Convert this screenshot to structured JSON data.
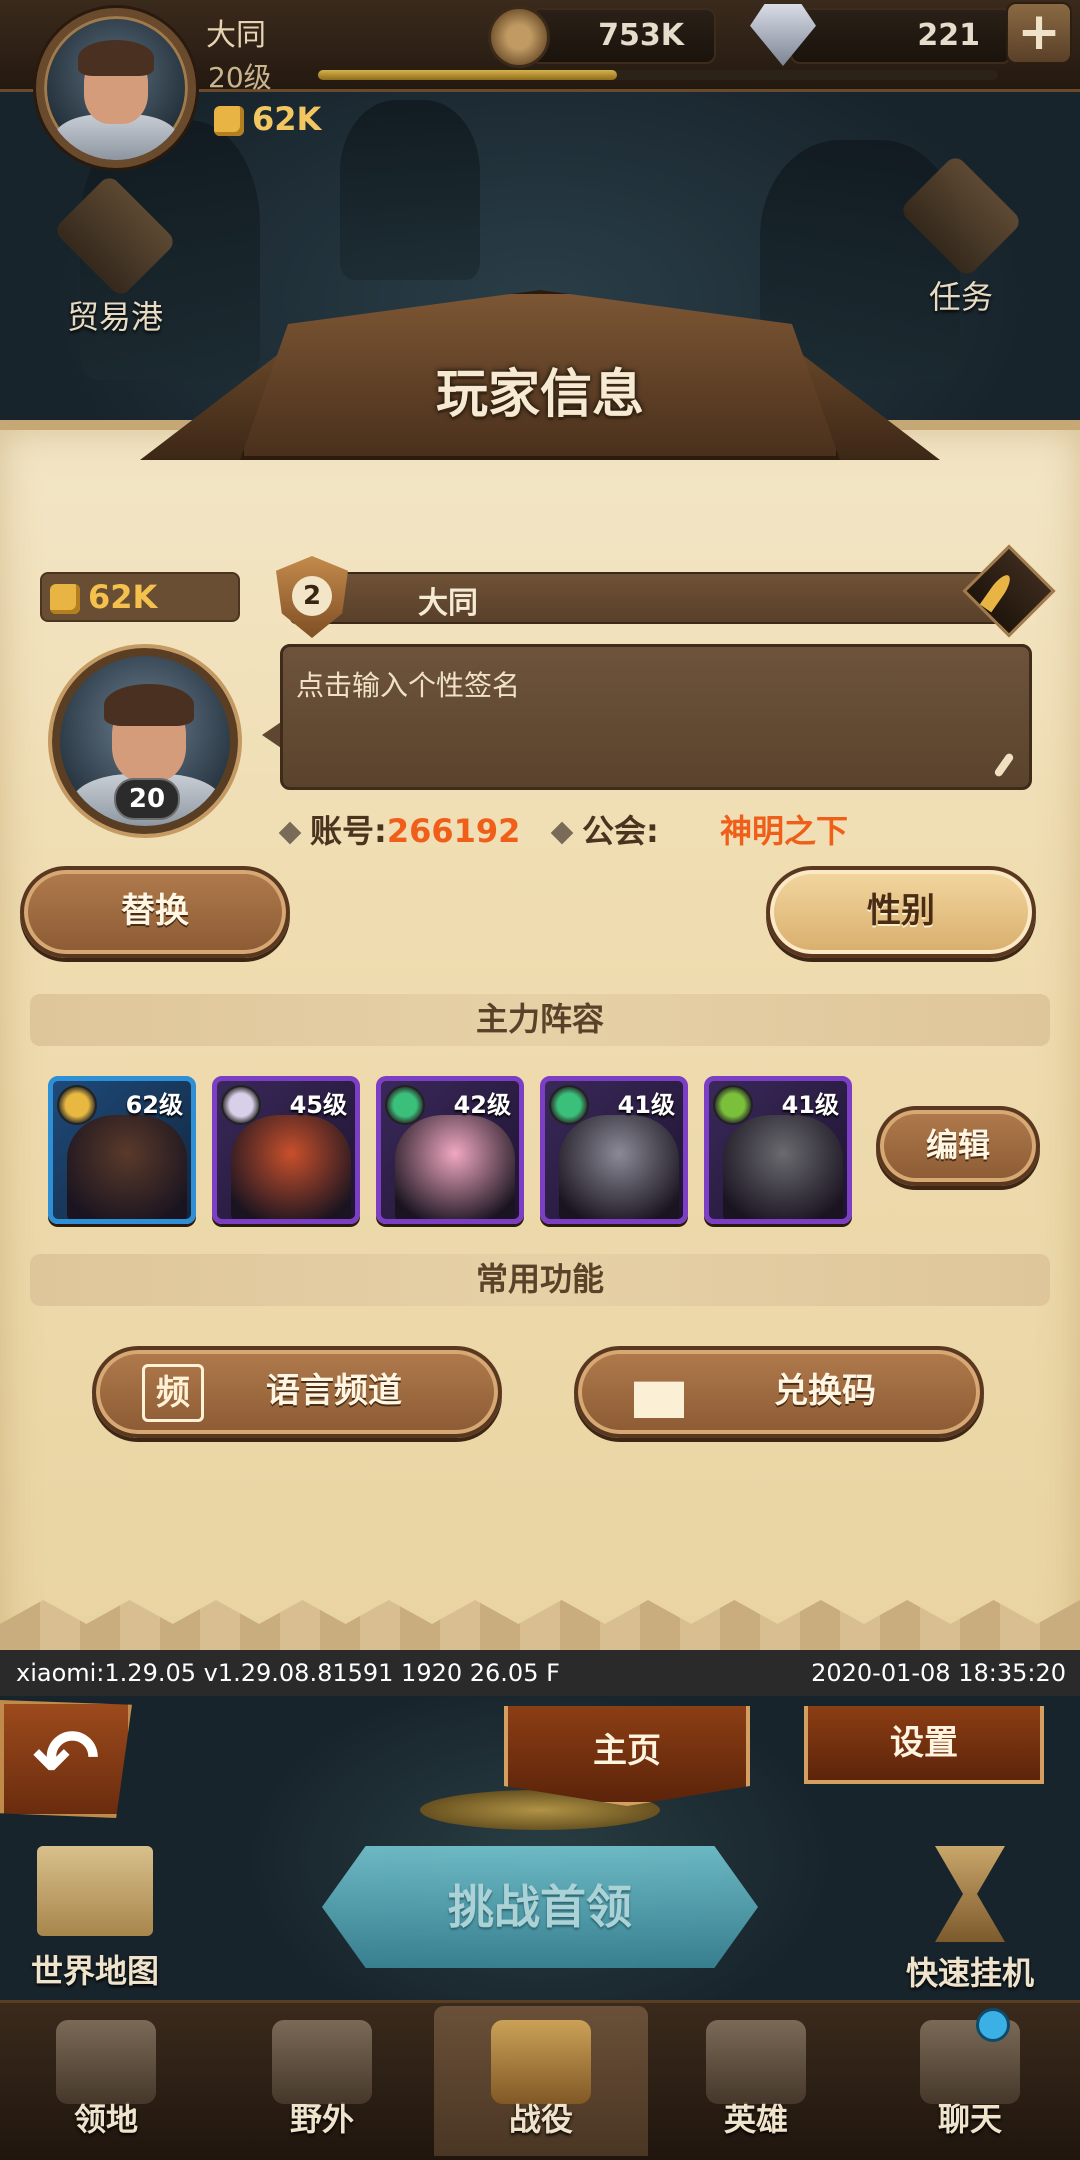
{
  "player": {
    "name": "大同",
    "level_text": "20级",
    "power": "62K",
    "avatar_level": "20",
    "rank": "2",
    "signature_placeholder": "点击输入个性签名",
    "account_label": "账号:",
    "account_id": "266192",
    "guild_label": "公会:",
    "guild_name": "神明之下",
    "xp_progress": 0.44
  },
  "resources": {
    "gold": "753K",
    "diamonds": "221"
  },
  "side_nav": {
    "trade_port": "贸易港",
    "quests": "任务"
  },
  "panel": {
    "title": "玩家信息",
    "replace_button": "替换",
    "gender_button": "性别",
    "lineup_section": "主力阵容",
    "edit_button": "编辑",
    "functions_section": "常用功能",
    "language_channel_button": "语言频道",
    "language_icon_glyph": "频",
    "redeem_code_button": "兑换码"
  },
  "lineup": [
    {
      "level": "62级",
      "frame": "blue",
      "faction_color": "#e8b840",
      "art_color": "#5a3a2a"
    },
    {
      "level": "45级",
      "frame": "purple",
      "faction_color": "#d8d0e8",
      "art_color": "#c8502c"
    },
    {
      "level": "42级",
      "frame": "purple",
      "faction_color": "#3ac07a",
      "art_color": "#f0a8c0"
    },
    {
      "level": "41级",
      "frame": "purple",
      "faction_color": "#3ac07a",
      "art_color": "#8a8a96"
    },
    {
      "level": "41级",
      "frame": "purple",
      "faction_color": "#7ac03a",
      "art_color": "#6a6a70"
    }
  ],
  "version": {
    "left": "xiaomi:1.29.05  v1.29.08.81591 1920 26.05 F",
    "right": "2020-01-08 18:35:20"
  },
  "hud": {
    "home_tab": "主页",
    "settings_tab": "设置",
    "world_map": "世界地图",
    "challenge_boss": "挑战首领",
    "quick_idle": "快速挂机"
  },
  "bottom_nav": {
    "territory": "领地",
    "wilderness": "野外",
    "campaign": "战役",
    "heroes": "英雄",
    "chat": "聊天"
  }
}
